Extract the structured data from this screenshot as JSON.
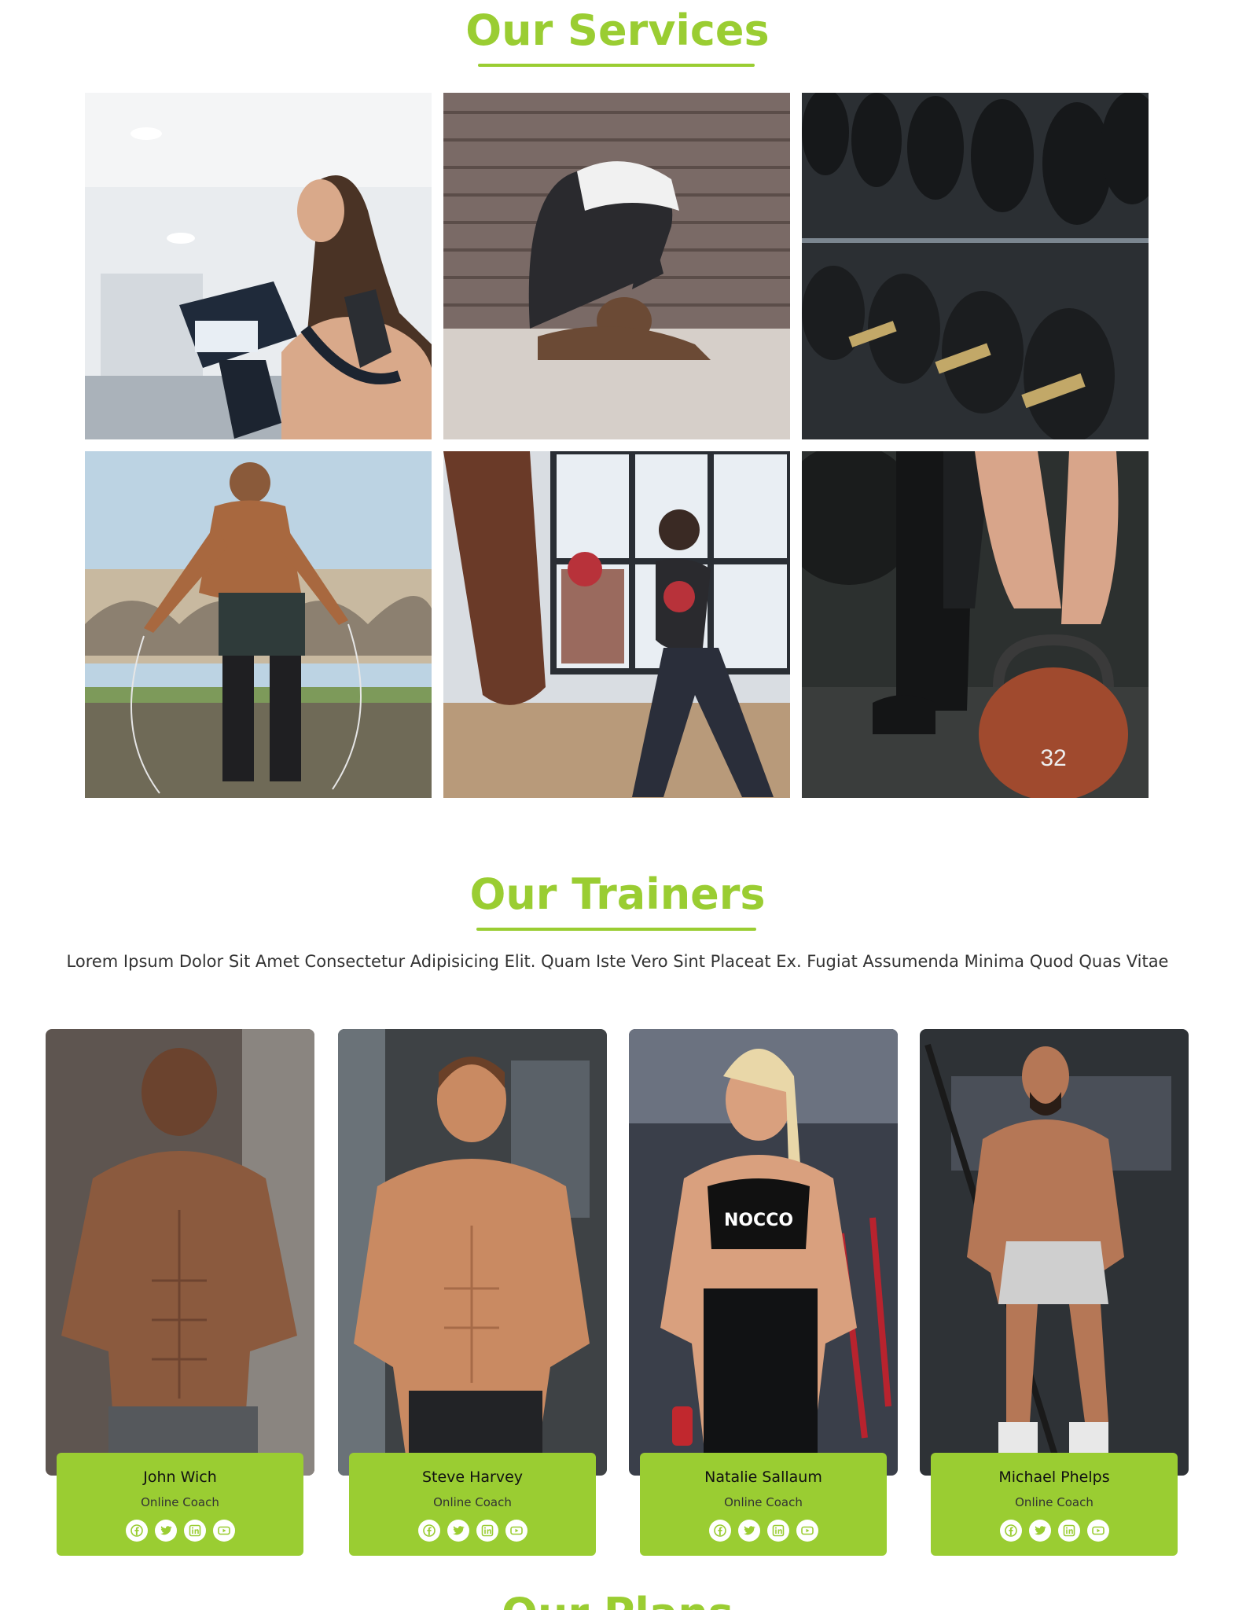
{
  "services": {
    "title": "Our Services",
    "tiles": [
      {
        "subject": "treadmill-workout"
      },
      {
        "subject": "yoga-stretch"
      },
      {
        "subject": "dumbbell-rack"
      },
      {
        "subject": "jump-rope"
      },
      {
        "subject": "boxing"
      },
      {
        "subject": "kettlebell"
      }
    ]
  },
  "trainers": {
    "title": "Our Trainers",
    "intro": "Lorem Ipsum Dolor Sit Amet Consectetur Adipisicing Elit. Quam Iste Vero Sint Placeat Ex. Fugiat Assumenda Minima Quod Quas Vitae",
    "items": [
      {
        "name": "John Wich",
        "role": "Online Coach"
      },
      {
        "name": "Steve Harvey",
        "role": "Online Coach"
      },
      {
        "name": "Natalie Sallaum",
        "role": "Online Coach"
      },
      {
        "name": "Michael Phelps",
        "role": "Online Coach"
      }
    ],
    "social_icons": [
      "facebook-icon",
      "twitter-icon",
      "linkedin-icon",
      "youtube-icon"
    ]
  },
  "next_section": {
    "title": "Our Plans"
  },
  "colors": {
    "accent": "#9acd32",
    "card_bg": "#9acd32",
    "text": "#333333"
  }
}
